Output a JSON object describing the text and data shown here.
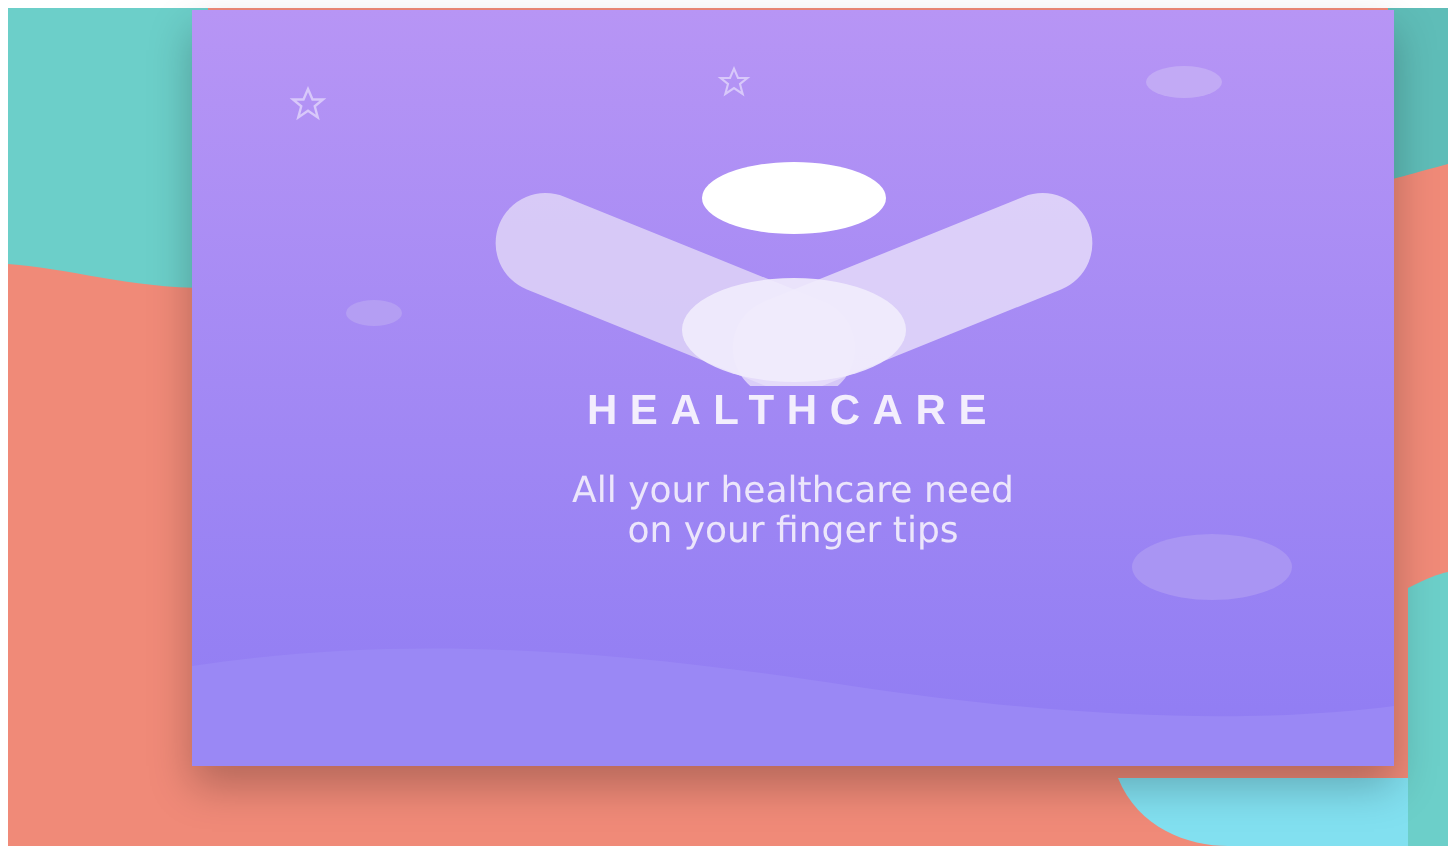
{
  "splash": {
    "title": "HEALTHCARE",
    "tagline_lines": [
      "All your healthcare need",
      "on your finger tips"
    ]
  }
}
